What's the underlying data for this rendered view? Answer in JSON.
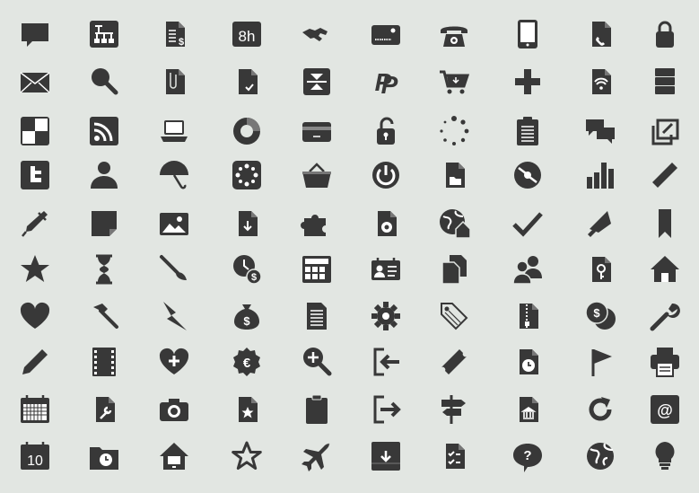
{
  "palette": {
    "background": "#e2e6e2",
    "icon_dark": "#333333",
    "icon_mid": "#444444",
    "highlight": "#ffffff"
  },
  "rows": [
    [
      "speech-bubble-icon",
      "sitemap-icon",
      "invoice-icon",
      "hours-badge-icon",
      "handshake-icon",
      "credit-card-icon",
      "telephone-icon",
      "tablet-icon",
      "phone-document-icon",
      "padlock-icon"
    ],
    [
      "envelope-icon",
      "magnifier-icon",
      "attachment-document-icon",
      "checked-document-icon",
      "compress-icon",
      "paypal-icon",
      "shopping-cart-icon",
      "plus-icon",
      "wifi-document-icon",
      "server-icon"
    ],
    [
      "checkerboard-icon",
      "rss-icon",
      "laptop-icon",
      "donut-chart-icon",
      "bank-card-icon",
      "unlocked-icon",
      "loading-spinner-icon",
      "clipboard-list-icon",
      "chat-bubbles-icon",
      "external-link-icon"
    ],
    [
      "twitter-icon",
      "user-icon",
      "umbrella-icon",
      "film-reel-icon",
      "basket-icon",
      "power-icon",
      "folder-document-icon",
      "disc-icon",
      "bar-chart-icon",
      "ruler-icon"
    ],
    [
      "fountain-pen-icon",
      "note-icon",
      "picture-icon",
      "download-document-icon",
      "puzzle-icon",
      "settings-document-icon",
      "globe-home-icon",
      "checkmark-icon",
      "megaphone-icon",
      "bookmark-icon"
    ],
    [
      "star-icon",
      "hourglass-icon",
      "paintbrush-icon",
      "time-money-icon",
      "calculator-icon",
      "id-card-icon",
      "copy-documents-icon",
      "users-icon",
      "key-document-icon",
      "home-icon"
    ],
    [
      "heart-icon",
      "hammer-icon",
      "lightning-icon",
      "money-bag-icon",
      "document-list-icon",
      "gear-icon",
      "tag-icon",
      "zip-file-icon",
      "coins-icon",
      "wrench-icon"
    ],
    [
      "pencil-icon",
      "film-strip-icon",
      "health-icon",
      "euro-badge-icon",
      "zoom-in-icon",
      "sign-in-icon",
      "ticket-icon",
      "clock-document-icon",
      "flag-icon",
      "printer-icon"
    ],
    [
      "calendar-grid-icon",
      "tools-document-icon",
      "camera-icon",
      "starred-document-icon",
      "clipboard-icon",
      "sign-out-icon",
      "signpost-icon",
      "bank-document-icon",
      "refresh-icon",
      "at-sign-icon"
    ],
    [
      "calendar-day-icon",
      "clock-folder-icon",
      "home-screen-icon",
      "star-outline-icon",
      "airplane-icon",
      "inbox-download-icon",
      "checklist-document-icon",
      "help-bubble-icon",
      "globe-icon",
      "lightbulb-icon"
    ]
  ],
  "labels": {
    "hours": "8h",
    "paypal": "P",
    "invoice_currency": "$",
    "time_currency": "$",
    "money_bag": "$",
    "coins": "$",
    "euro": "€",
    "at": "@",
    "help": "?",
    "calendar_day": "10"
  }
}
